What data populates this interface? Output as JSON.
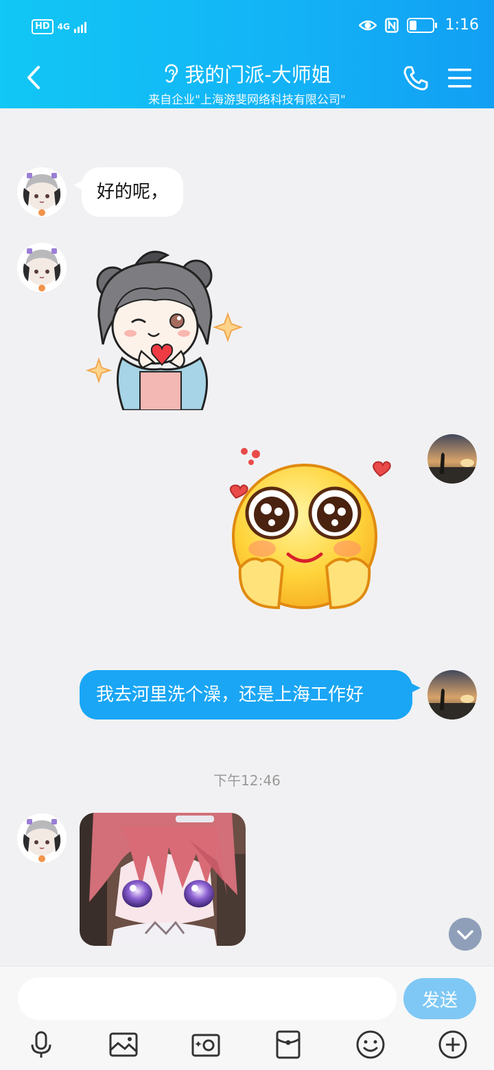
{
  "status": {
    "hd_label": "HD",
    "network_label": "4G",
    "time": "1:16"
  },
  "header": {
    "title": "我的门派-大师姐",
    "subtitle": "来自企业\"上海游斐网络科技有限公司\""
  },
  "messages": {
    "m1_text": "好的呢，",
    "m4_text": "我去河里洗个澡，还是上海工作好"
  },
  "timestamp": "下午12:46",
  "input": {
    "placeholder": "",
    "send_label": "发送"
  },
  "colors": {
    "header_gradient_start": "#11c7f5",
    "header_gradient_end": "#129ff4",
    "sent_bubble": "#1aa6f5",
    "send_button": "#7fc8f5"
  },
  "icons": {
    "back": "chevron-left-icon",
    "hearing": "ear-icon",
    "call": "phone-icon",
    "menu": "hamburger-icon",
    "voice": "microphone-icon",
    "photo": "image-icon",
    "camera": "camera-icon",
    "redpacket": "red-packet-icon",
    "emoji": "emoji-icon",
    "more": "plus-icon"
  }
}
